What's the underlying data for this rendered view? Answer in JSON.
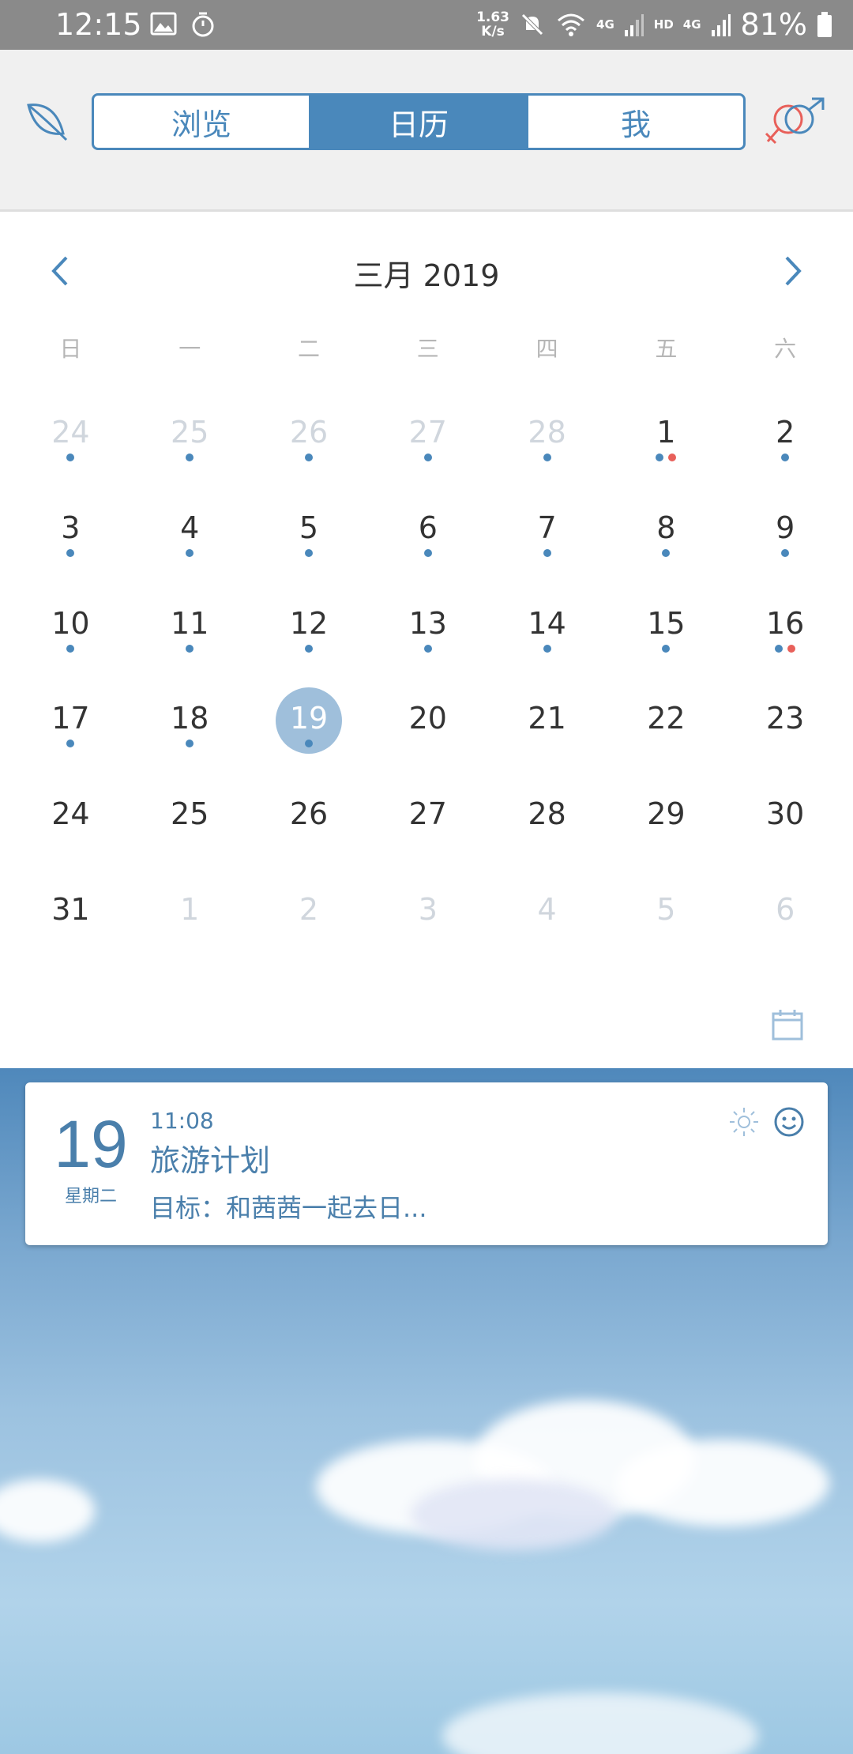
{
  "status_bar": {
    "time": "12:15",
    "net_speed_value": "1.63",
    "net_speed_unit": "K/s",
    "net_4g": "4G",
    "hd": "HD",
    "hd_4g": "4G",
    "battery": "81%"
  },
  "header": {
    "tabs": [
      {
        "label": "浏览",
        "active": false
      },
      {
        "label": "日历",
        "active": true
      },
      {
        "label": "我",
        "active": false
      }
    ]
  },
  "calendar": {
    "month_title": "三月 2019",
    "weekdays": [
      "日",
      "一",
      "二",
      "三",
      "四",
      "五",
      "六"
    ],
    "days": [
      {
        "label": "24",
        "other": true,
        "dots": [
          "blue"
        ]
      },
      {
        "label": "25",
        "other": true,
        "dots": [
          "blue"
        ]
      },
      {
        "label": "26",
        "other": true,
        "dots": [
          "blue"
        ]
      },
      {
        "label": "27",
        "other": true,
        "dots": [
          "blue"
        ]
      },
      {
        "label": "28",
        "other": true,
        "dots": [
          "blue"
        ]
      },
      {
        "label": "1",
        "other": false,
        "dots": [
          "blue",
          "red"
        ]
      },
      {
        "label": "2",
        "other": false,
        "dots": [
          "blue"
        ]
      },
      {
        "label": "3",
        "other": false,
        "dots": [
          "blue"
        ]
      },
      {
        "label": "4",
        "other": false,
        "dots": [
          "blue"
        ]
      },
      {
        "label": "5",
        "other": false,
        "dots": [
          "blue"
        ]
      },
      {
        "label": "6",
        "other": false,
        "dots": [
          "blue"
        ]
      },
      {
        "label": "7",
        "other": false,
        "dots": [
          "blue"
        ]
      },
      {
        "label": "8",
        "other": false,
        "dots": [
          "blue"
        ]
      },
      {
        "label": "9",
        "other": false,
        "dots": [
          "blue"
        ]
      },
      {
        "label": "10",
        "other": false,
        "dots": [
          "blue"
        ]
      },
      {
        "label": "11",
        "other": false,
        "dots": [
          "blue"
        ]
      },
      {
        "label": "12",
        "other": false,
        "dots": [
          "blue"
        ]
      },
      {
        "label": "13",
        "other": false,
        "dots": [
          "blue"
        ]
      },
      {
        "label": "14",
        "other": false,
        "dots": [
          "blue"
        ]
      },
      {
        "label": "15",
        "other": false,
        "dots": [
          "blue"
        ]
      },
      {
        "label": "16",
        "other": false,
        "dots": [
          "blue",
          "red"
        ]
      },
      {
        "label": "17",
        "other": false,
        "dots": [
          "blue"
        ]
      },
      {
        "label": "18",
        "other": false,
        "dots": [
          "blue"
        ]
      },
      {
        "label": "19",
        "other": false,
        "dots": [
          "blue"
        ],
        "selected": true
      },
      {
        "label": "20",
        "other": false,
        "dots": []
      },
      {
        "label": "21",
        "other": false,
        "dots": []
      },
      {
        "label": "22",
        "other": false,
        "dots": []
      },
      {
        "label": "23",
        "other": false,
        "dots": []
      },
      {
        "label": "24",
        "other": false,
        "dots": []
      },
      {
        "label": "25",
        "other": false,
        "dots": []
      },
      {
        "label": "26",
        "other": false,
        "dots": []
      },
      {
        "label": "27",
        "other": false,
        "dots": []
      },
      {
        "label": "28",
        "other": false,
        "dots": []
      },
      {
        "label": "29",
        "other": false,
        "dots": []
      },
      {
        "label": "30",
        "other": false,
        "dots": []
      },
      {
        "label": "31",
        "other": false,
        "dots": []
      },
      {
        "label": "1",
        "other": true,
        "dots": []
      },
      {
        "label": "2",
        "other": true,
        "dots": []
      },
      {
        "label": "3",
        "other": true,
        "dots": []
      },
      {
        "label": "4",
        "other": true,
        "dots": []
      },
      {
        "label": "5",
        "other": true,
        "dots": []
      },
      {
        "label": "6",
        "other": true,
        "dots": []
      }
    ]
  },
  "event": {
    "day": "19",
    "weekday": "星期二",
    "time": "11:08",
    "title": "旅游计划",
    "description": "目标：和茜茜一起去日..."
  },
  "icons": {
    "leaf": "leaf-icon",
    "gender": "gender-icon",
    "prev": "chevron-left-icon",
    "next": "chevron-right-icon",
    "calendar": "calendar-icon",
    "sun": "sun-icon",
    "smile": "smile-icon"
  },
  "colors": {
    "accent": "#4a88bb",
    "selected_day": "#9fbfdb",
    "dot_red": "#e8605a",
    "status_bar": "#8a8a8a"
  }
}
